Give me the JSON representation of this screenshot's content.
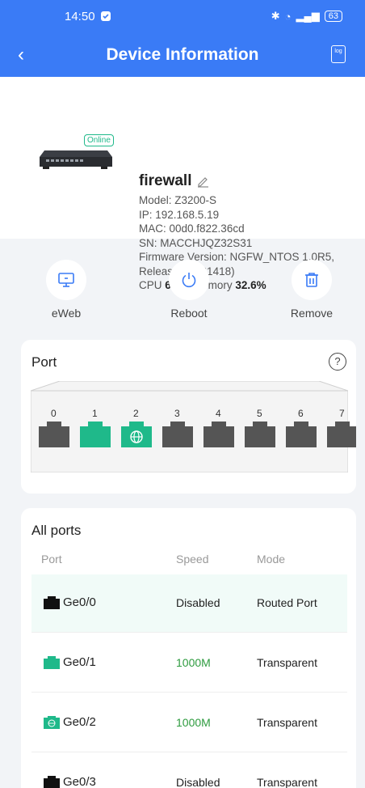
{
  "statusbar": {
    "time": "14:50",
    "battery": "63"
  },
  "header": {
    "title": "Device Information",
    "log_label": "log"
  },
  "device": {
    "name": "firewall",
    "status": "Online",
    "model": "Model: Z3200-S",
    "ip": "IP:  192.168.5.19",
    "mac": "MAC:  00d0.f822.36cd",
    "sn": "SN: MACCHJQZ32S31",
    "firmware": "Firmware Version: NGFW_NTOS 1.0R5, Release(03181418)",
    "cpu_label": "CPU",
    "cpu_value": "6.4%",
    "memory_label": "Memory",
    "memory_value": "32.6%"
  },
  "actions": [
    {
      "label": "eWeb",
      "icon": "monitor-icon"
    },
    {
      "label": "Reboot",
      "icon": "power-icon"
    },
    {
      "label": "Remove",
      "icon": "trash-icon"
    }
  ],
  "port_panel": {
    "title": "Port",
    "ports": [
      {
        "num": "0",
        "state": "down"
      },
      {
        "num": "1",
        "state": "up"
      },
      {
        "num": "2",
        "state": "wan"
      },
      {
        "num": "3",
        "state": "down"
      },
      {
        "num": "4",
        "state": "down"
      },
      {
        "num": "5",
        "state": "down"
      },
      {
        "num": "6",
        "state": "down"
      },
      {
        "num": "7",
        "state": "down"
      }
    ]
  },
  "all_ports": {
    "title": "All ports",
    "headers": {
      "port": "Port",
      "speed": "Speed",
      "mode": "Mode"
    },
    "rows": [
      {
        "port": "Ge0/0",
        "speed": "Disabled",
        "mode": "Routed Port",
        "state": "down"
      },
      {
        "port": "Ge0/1",
        "speed": "1000M",
        "mode": "Transparent",
        "state": "up"
      },
      {
        "port": "Ge0/2",
        "speed": "1000M",
        "mode": "Transparent",
        "state": "wan"
      },
      {
        "port": "Ge0/3",
        "speed": "Disabled",
        "mode": "Transparent",
        "state": "down"
      }
    ]
  },
  "colors": {
    "accent": "#3a7bf6",
    "up": "#1fb98a",
    "down": "#555555",
    "speed_up": "#2e9b3f"
  }
}
